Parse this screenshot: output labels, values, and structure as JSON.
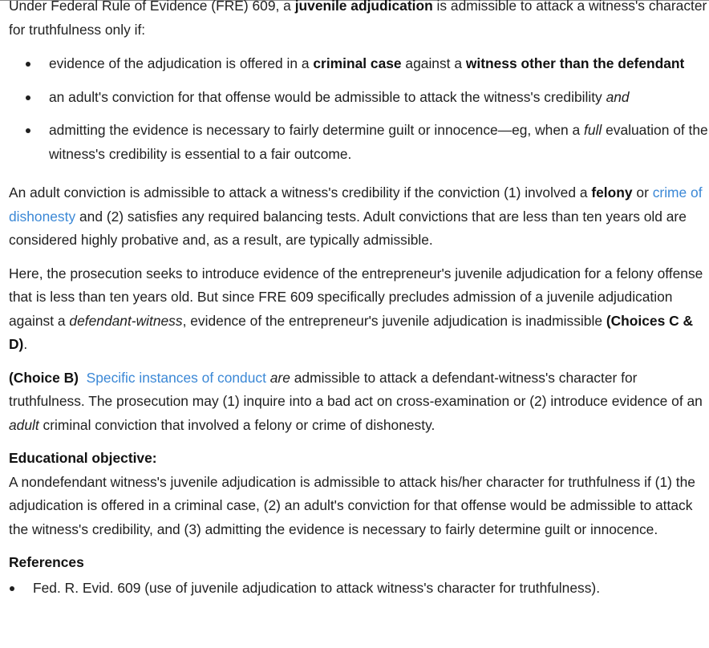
{
  "intro": {
    "t1": "Under Federal Rule of Evidence (FRE) 609, a ",
    "b1": "juvenile adjudication",
    "t2": " is admissible to attack a witness's character for truthfulness only if:"
  },
  "bullets": {
    "b1": {
      "t1": "evidence of the adjudication is offered in a ",
      "bold1": "criminal case",
      "t2": " against a ",
      "bold2": "witness other than the defendant"
    },
    "b2": {
      "t1": "an adult's conviction for that offense would be admissible to attack the witness's credibility ",
      "ital": "and"
    },
    "b3": {
      "t1": "admitting the evidence is necessary to fairly determine guilt or innocence—eg, when a ",
      "ital": "full",
      "t2": " evaluation of the witness's credibility is essential to a fair outcome."
    }
  },
  "p_adult": {
    "t1": "An adult conviction is admissible to attack a witness's credibility if the conviction (1) involved a ",
    "bold": "felony",
    "t2": " or ",
    "link": "crime of dishonesty",
    "t3": " and (2) satisfies any required balancing tests.  Adult convictions that are less than ten years old are considered highly probative and, as a result, are typically admissible."
  },
  "p_here": {
    "t1": "Here, the prosecution seeks to introduce evidence of the entrepreneur's juvenile adjudication for a felony offense that is less than ten years old.  But since FRE 609 specifically precludes admission of a juvenile adjudication against a ",
    "ital": "defendant-witness",
    "t2": ", evidence of the entrepreneur's juvenile adjudication is inadmissible ",
    "bold": "(Choices C & D)",
    "t3": "."
  },
  "p_choiceb": {
    "bold": "(Choice B)",
    "sp": "  ",
    "link": "Specific instances of conduct",
    "sp2": " ",
    "ital1": "are",
    "t1": " admissible to attack a defendant-witness's character for truthfulness.  The prosecution may (1) inquire into a bad act on cross-examination or (2) introduce evidence of an ",
    "ital2": "adult",
    "t2": " criminal conviction that involved a felony or crime of dishonesty."
  },
  "objective": {
    "heading": "Educational objective:",
    "text": "A nondefendant witness's juvenile adjudication is admissible to attack his/her character for truthfulness if (1) the adjudication is offered in a criminal case, (2) an adult's conviction for that offense would be admissible to attack the witness's credibility, and (3) admitting the evidence is necessary to fairly determine guilt or innocence."
  },
  "references": {
    "heading": "References",
    "items": [
      "Fed. R. Evid. 609 (use of juvenile adjudication to attack witness's character for truthfulness)."
    ]
  },
  "colors": {
    "text": "#1f1f1f",
    "link": "#3b88d6"
  }
}
